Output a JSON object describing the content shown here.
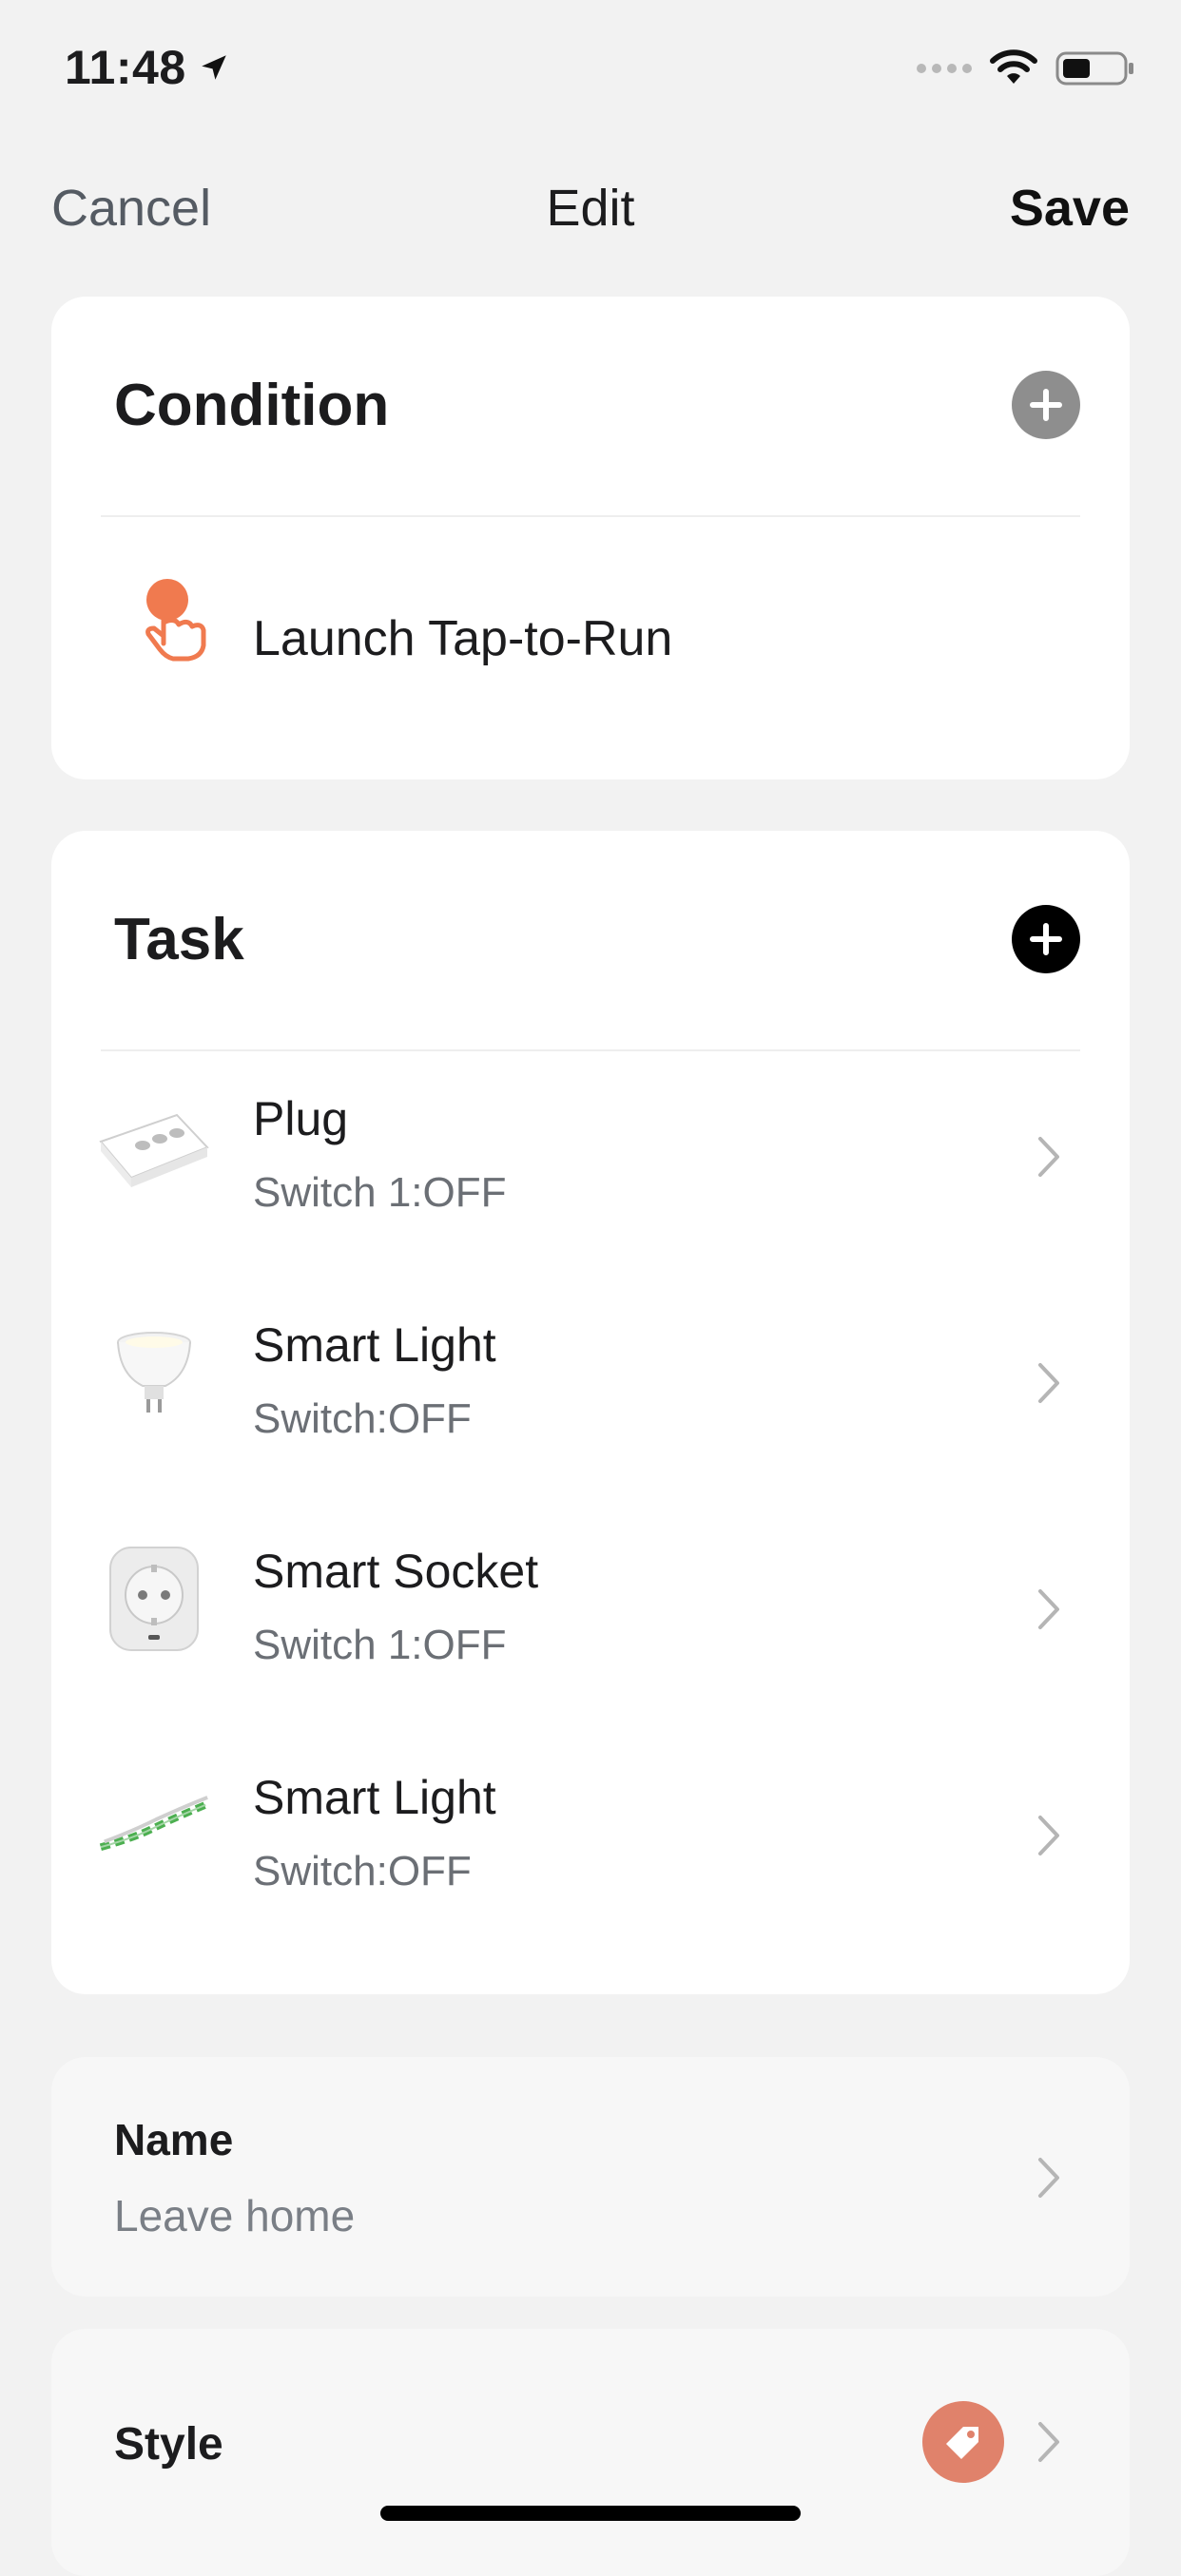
{
  "status": {
    "time": "11:48"
  },
  "nav": {
    "cancel": "Cancel",
    "title": "Edit",
    "save": "Save"
  },
  "condition": {
    "title": "Condition",
    "item_label": "Launch Tap-to-Run",
    "icon": "tap-hand-icon",
    "accent": "#f07a4f"
  },
  "task": {
    "title": "Task",
    "items": [
      {
        "title": "Plug",
        "subtitle": "Switch 1:OFF",
        "icon": "power-strip-icon"
      },
      {
        "title": "Smart Light",
        "subtitle": "Switch:OFF",
        "icon": "bulb-icon"
      },
      {
        "title": "Smart Socket",
        "subtitle": "Switch 1:OFF",
        "icon": "socket-icon"
      },
      {
        "title": "Smart Light",
        "subtitle": "Switch:OFF",
        "icon": "led-strip-icon"
      }
    ]
  },
  "name_section": {
    "label": "Name",
    "value": "Leave home"
  },
  "style_section": {
    "label": "Style",
    "icon": "tag-icon",
    "accent": "#e0826b"
  }
}
